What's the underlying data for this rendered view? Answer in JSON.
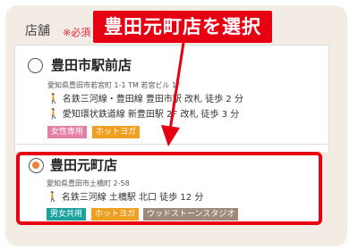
{
  "section": {
    "title": "店舗",
    "required": "※必須"
  },
  "banner": {
    "text": "豊田元町店を選択",
    "color": "#e60012"
  },
  "stores": [
    {
      "name": "豊田市駅前店",
      "selected": false,
      "address": "愛知県豊田市若宮町 1-1 TM 若宮ビル 1F",
      "access": [
        "名鉄三河線・豊田線 豊田市駅 改札 徒歩 2 分",
        "愛知環状鉄道線 新豊田駅 2F 改札 徒歩 3 分"
      ],
      "tags": [
        "女性専用",
        "ホットヨガ"
      ]
    },
    {
      "name": "豊田元町店",
      "selected": true,
      "address": "愛知県豊田市土橋町 2-58",
      "access": [
        "名鉄三河線 土橋駅 北口 徒歩 12 分"
      ],
      "tags": [
        "男女共用",
        "ホットヨガ",
        "ウッドストーンスタジオ"
      ]
    }
  ],
  "icons": {
    "walk": "person-walking-icon",
    "arrow": "red-arrow-icon"
  },
  "colors": {
    "highlight": "#e60012",
    "radio_selected": "#f08040",
    "tag_women": "#e37fa3",
    "tag_hotyoga": "#f0a020",
    "tag_unisex": "#1aa39c",
    "tag_woodstone": "#9e8a7a"
  }
}
